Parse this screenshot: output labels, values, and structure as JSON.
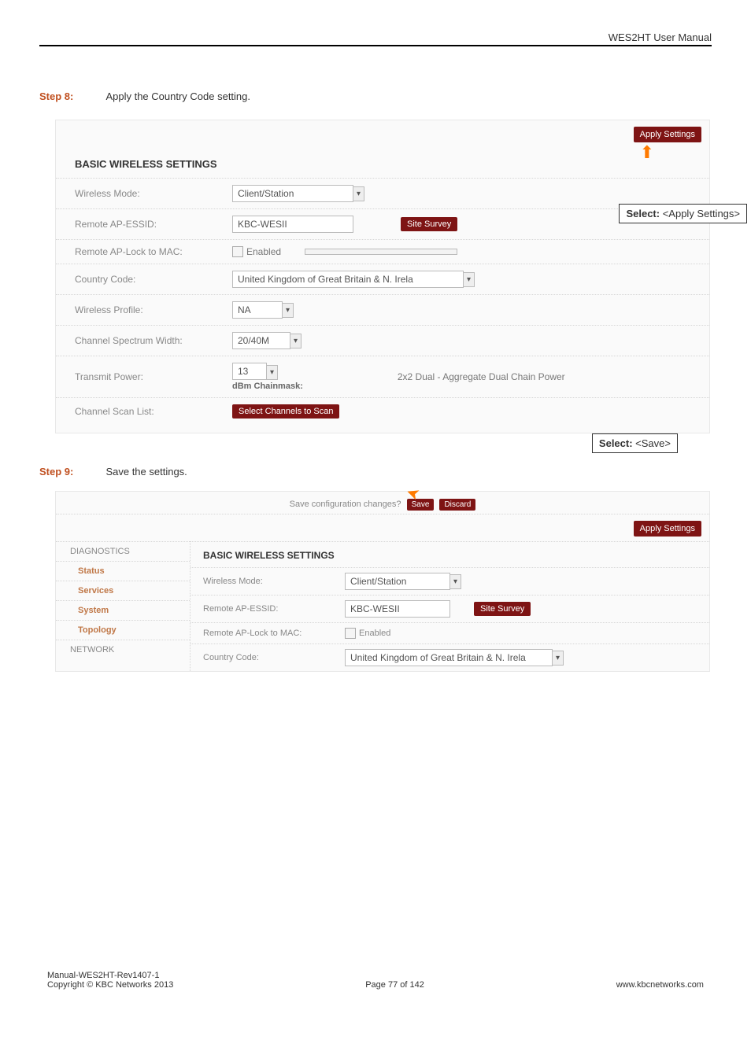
{
  "header": {
    "title": "WES2HT User Manual"
  },
  "step8": {
    "label": "Step 8:",
    "text": "Apply the Country Code setting."
  },
  "step9": {
    "label": "Step 9:",
    "text": "Save the settings."
  },
  "callouts": {
    "apply": {
      "prefix": "Select:  ",
      "value": "<Apply Settings>"
    },
    "save": {
      "prefix": "Select:  ",
      "value": "<Save>"
    }
  },
  "panel1": {
    "applyBtn": "Apply Settings",
    "sectionTitle": "BASIC WIRELESS SETTINGS",
    "rows": {
      "wirelessMode": {
        "label": "Wireless Mode:",
        "value": "Client/Station"
      },
      "remoteEssid": {
        "label": "Remote AP-ESSID:",
        "value": "KBC-WESII",
        "siteSurvey": "Site Survey"
      },
      "remoteLock": {
        "label": "Remote AP-Lock to MAC:",
        "value": "Enabled"
      },
      "countryCode": {
        "label": "Country Code:",
        "value": "United Kingdom of Great Britain & N. Irela"
      },
      "wirelessProfile": {
        "label": "Wireless Profile:",
        "value": "NA"
      },
      "channelWidth": {
        "label": "Channel Spectrum Width:",
        "value": "20/40M"
      },
      "txPower": {
        "label": "Transmit Power:",
        "value": "13",
        "sub": "dBm Chainmask:",
        "note": "2x2 Dual - Aggregate Dual Chain Power"
      },
      "scanList": {
        "label": "Channel Scan List:",
        "btn": "Select Channels to Scan"
      }
    }
  },
  "panel2": {
    "saveBar": {
      "text": "Save configuration changes?",
      "save": "Save",
      "discard": "Discard"
    },
    "applyBtn": "Apply Settings",
    "sidebar": {
      "diagnostics": "DIAGNOSTICS",
      "status": "Status",
      "services": "Services",
      "system": "System",
      "topology": "Topology",
      "network": "NETWORK"
    },
    "main": {
      "sectionTitle": "BASIC WIRELESS SETTINGS",
      "wirelessMode": {
        "label": "Wireless Mode:",
        "value": "Client/Station"
      },
      "remoteEssid": {
        "label": "Remote AP-ESSID:",
        "value": "KBC-WESII",
        "siteSurvey": "Site Survey"
      },
      "remoteLock": {
        "label": "Remote AP-Lock to MAC:",
        "value": "Enabled"
      },
      "countryCode": {
        "label": "Country Code:",
        "value": "United Kingdom of Great Britain & N. Irela"
      }
    }
  },
  "footer": {
    "left1": "Manual-WES2HT-Rev1407-1",
    "left2": "Copyright © KBC Networks 2013",
    "center": "Page 77 of 142",
    "right": "www.kbcnetworks.com"
  }
}
